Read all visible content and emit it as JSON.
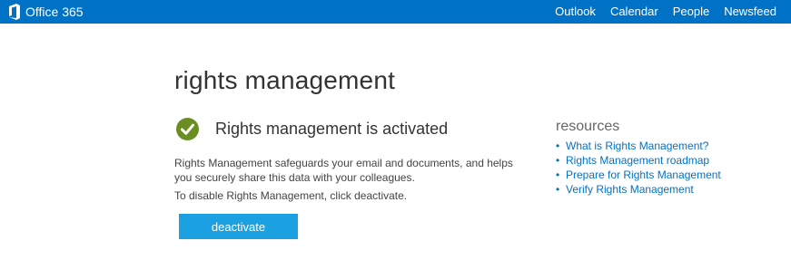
{
  "header": {
    "brand": "Office 365",
    "nav": [
      "Outlook",
      "Calendar",
      "People",
      "Newsfeed"
    ]
  },
  "main": {
    "title": "rights management",
    "status": "Rights management is activated",
    "description_line1": "Rights Management safeguards your email and documents, and helps",
    "description_line2": "you securely share this data with your colleagues.",
    "instruction": "To disable Rights Management, click deactivate.",
    "deactivate_label": "deactivate"
  },
  "resources": {
    "title": "resources",
    "links": [
      "What is Rights Management?",
      "Rights Management roadmap",
      "Prepare for Rights Management",
      "Verify Rights Management"
    ]
  },
  "colors": {
    "topbar": "#0072c6",
    "button": "#1ba1e2",
    "check": "#6b8e23",
    "link": "#0072c6"
  },
  "icons": {
    "brand": "office-logo-icon",
    "status": "checkmark-circle-icon",
    "bullet": "bullet-dot"
  }
}
